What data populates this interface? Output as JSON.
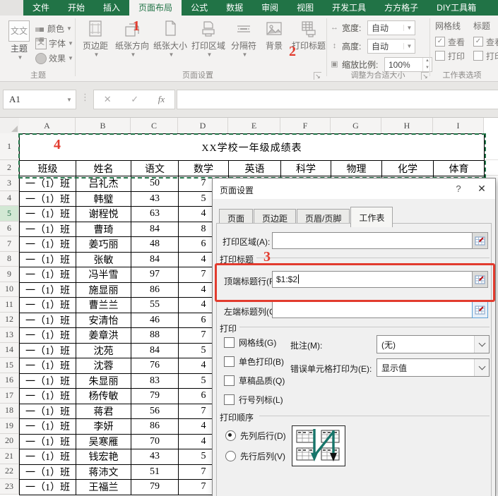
{
  "colors": {
    "brand_green": "#217346",
    "annotation_red": "#e23b2e",
    "ants_green": "#1e7145"
  },
  "annotations": {
    "step1": "1",
    "step2": "2",
    "step3": "3",
    "step4": "4"
  },
  "ribbon": {
    "tabs": [
      {
        "label": "文件",
        "selected": false
      },
      {
        "label": "开始",
        "selected": false
      },
      {
        "label": "插入",
        "selected": false
      },
      {
        "label": "页面布局",
        "selected": true
      },
      {
        "label": "公式",
        "selected": false
      },
      {
        "label": "数据",
        "selected": false
      },
      {
        "label": "审阅",
        "selected": false
      },
      {
        "label": "视图",
        "selected": false
      },
      {
        "label": "开发工具",
        "selected": false
      },
      {
        "label": "方方格子",
        "selected": false
      },
      {
        "label": "DIY工具箱",
        "selected": false
      }
    ],
    "themes_group": {
      "label": "主题",
      "big_button": "主题",
      "icon_text": "文文",
      "items": [
        "颜色",
        "字体",
        "效果"
      ],
      "font_icon_text": "文"
    },
    "page_setup_group": {
      "label": "页面设置",
      "items": [
        "页边距",
        "纸张方向",
        "纸张大小",
        "打印区域",
        "分隔符",
        "背景",
        "打印标题"
      ]
    },
    "scale_group": {
      "label": "调整为合适大小",
      "width_label": "宽度:",
      "width_value": "自动",
      "height_label": "高度:",
      "height_value": "自动",
      "scale_label": "缩放比例:",
      "scale_value": "100%"
    },
    "sheet_options_group": {
      "label": "工作表选项",
      "col1": "网格线",
      "col2": "标题",
      "view_label": "查看",
      "print_label": "打印"
    }
  },
  "formula_row": {
    "name_box": "A1",
    "cancel": "✕",
    "enter": "✓",
    "fx": "fx",
    "formula_value": ""
  },
  "sheet": {
    "columns": [
      "A",
      "B",
      "C",
      "D",
      "E",
      "F",
      "G",
      "H",
      "I"
    ],
    "title": "XX学校一年级成绩表",
    "header_row": [
      "班级",
      "姓名",
      "语文",
      "数学",
      "英语",
      "科学",
      "物理",
      "化学",
      "体育"
    ],
    "selected_row_header": 5,
    "rows": [
      {
        "class": "一（1）班",
        "name": "吕礼杰",
        "chinese": "50",
        "math": "7"
      },
      {
        "class": "一（1）班",
        "name": "韩璧",
        "chinese": "43",
        "math": "5"
      },
      {
        "class": "一（1）班",
        "name": "谢程悦",
        "chinese": "63",
        "math": "4"
      },
      {
        "class": "一（1）班",
        "name": "曹琦",
        "chinese": "84",
        "math": "8"
      },
      {
        "class": "一（1）班",
        "name": "姜巧丽",
        "chinese": "48",
        "math": "6"
      },
      {
        "class": "一（1）班",
        "name": "张敏",
        "chinese": "84",
        "math": "4"
      },
      {
        "class": "一（1）班",
        "name": "冯半雪",
        "chinese": "97",
        "math": "7"
      },
      {
        "class": "一（1）班",
        "name": "施显丽",
        "chinese": "86",
        "math": "4"
      },
      {
        "class": "一（1）班",
        "name": "曹兰兰",
        "chinese": "55",
        "math": "4"
      },
      {
        "class": "一（1）班",
        "name": "安清怡",
        "chinese": "46",
        "math": "6"
      },
      {
        "class": "一（1）班",
        "name": "姜章洪",
        "chinese": "88",
        "math": "7"
      },
      {
        "class": "一（1）班",
        "name": "沈苑",
        "chinese": "84",
        "math": "5"
      },
      {
        "class": "一（1）班",
        "name": "沈蓉",
        "chinese": "76",
        "math": "4"
      },
      {
        "class": "一（1）班",
        "name": "朱显丽",
        "chinese": "83",
        "math": "5"
      },
      {
        "class": "一（1）班",
        "name": "杨传敏",
        "chinese": "79",
        "math": "6"
      },
      {
        "class": "一（1）班",
        "name": "蒋君",
        "chinese": "56",
        "math": "7"
      },
      {
        "class": "一（1）班",
        "name": "李妍",
        "chinese": "86",
        "math": "4"
      },
      {
        "class": "一（1）班",
        "name": "吴寒雁",
        "chinese": "70",
        "math": "4"
      },
      {
        "class": "一（1）班",
        "name": "钱宏艳",
        "chinese": "43",
        "math": "5"
      },
      {
        "class": "一（1）班",
        "name": "蒋沛文",
        "chinese": "51",
        "math": "7"
      },
      {
        "class": "一（1）班",
        "name": "王福兰",
        "chinese": "79",
        "math": "7"
      }
    ]
  },
  "dialog": {
    "title": "页面设置",
    "help": "?",
    "close": "✕",
    "tabs": [
      "页面",
      "页边距",
      "页眉/页脚",
      "工作表"
    ],
    "selected_tab": "工作表",
    "print_area_label": "打印区域(A):",
    "print_area_value": "",
    "print_titles_group": "打印标题",
    "top_rows_label": "顶端标题行(R):",
    "top_rows_value": "$1:$2",
    "left_cols_label": "左端标题列(C):",
    "left_cols_value": "",
    "print_group": "打印",
    "checkboxes": [
      {
        "label": "网格线(G)",
        "checked": false
      },
      {
        "label": "单色打印(B)",
        "checked": false
      },
      {
        "label": "草稿品质(Q)",
        "checked": false
      },
      {
        "label": "行号列标(L)",
        "checked": false
      }
    ],
    "comments_label": "批注(M):",
    "comments_value": "(无)",
    "errors_label": "错误单元格打印为(E):",
    "errors_value": "显示值",
    "order_group": "打印顺序",
    "order_options": [
      {
        "label": "先列后行(D)",
        "selected": true
      },
      {
        "label": "先行后列(V)",
        "selected": false
      }
    ]
  }
}
